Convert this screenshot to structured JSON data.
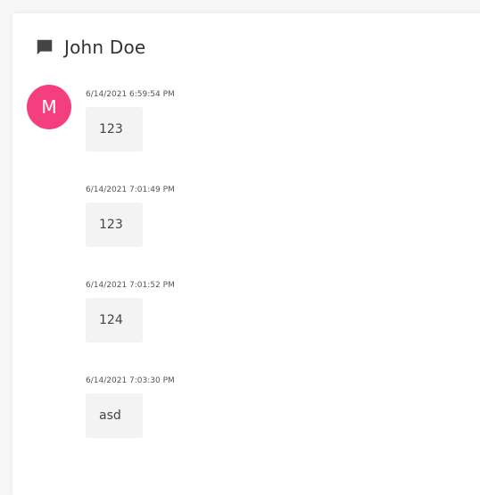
{
  "chat": {
    "contact_name": "John Doe",
    "avatar_initial": "M",
    "avatar_color": "#f43f7e",
    "messages": [
      {
        "timestamp": "6/14/2021 6:59:54 PM",
        "text": "123"
      },
      {
        "timestamp": "6/14/2021 7:01:49 PM",
        "text": "123"
      },
      {
        "timestamp": "6/14/2021 7:01:52 PM",
        "text": "124"
      },
      {
        "timestamp": "6/14/2021 7:03:30 PM",
        "text": "asd"
      }
    ]
  },
  "icons": {
    "header": "chat-bubble-icon"
  }
}
